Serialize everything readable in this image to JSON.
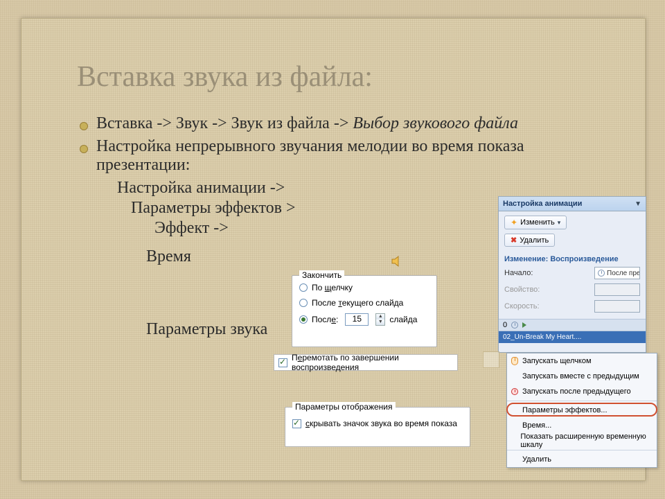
{
  "title": "Вставка звука из файла:",
  "bullets": {
    "b1a": "Вставка -> Звук -> Звук из файла -> ",
    "b1b": "Выбор звукового файла",
    "b2": "Настройка непрерывного  звучания мелодии во время показа презентации:",
    "l2": "Настройка анимации ->",
    "l3a": "Параметры эффектов   >",
    "l4": "Эффект ->",
    "l3b": "Время",
    "l3c": "Параметры звука"
  },
  "end_group": {
    "legend": "Закончить",
    "r1_pre": "По ",
    "r1_u": "щ",
    "r1_post": "елчку",
    "r2_pre": "После ",
    "r2_u": "т",
    "r2_post": "екущего слайда",
    "r3_pre": "Посл",
    "r3_u": "е",
    "r3_post": ":",
    "r3_val": "15",
    "r3_suf": "слайда"
  },
  "rewind": {
    "pre": "П",
    "u": "е",
    "post": "ремотать по завершении воспроизведения"
  },
  "params_disp": {
    "legend": "Параметры отображения",
    "pre": "",
    "u": "с",
    "post": "крывать значок звука во время показа"
  },
  "anim": {
    "title": "Настройка анимации",
    "btn_change": "Изменить",
    "btn_delete": "Удалить",
    "sub": "Изменение: Воспроизведение",
    "f1": "Начало:",
    "f1v": "После пред",
    "f2": "Свойство:",
    "f3": "Скорость:",
    "track_idx": "0",
    "track": "02_Un-Break My Heart...."
  },
  "menu": {
    "m1": "Запускать щелчком",
    "m2": "Запускать вместе с предыдущим",
    "m3": "Запускать после предыдущего",
    "m4": "Параметры эффектов...",
    "m5": "Время...",
    "m6": "Показать расширенную временную шкалу",
    "m7": "Удалить"
  }
}
